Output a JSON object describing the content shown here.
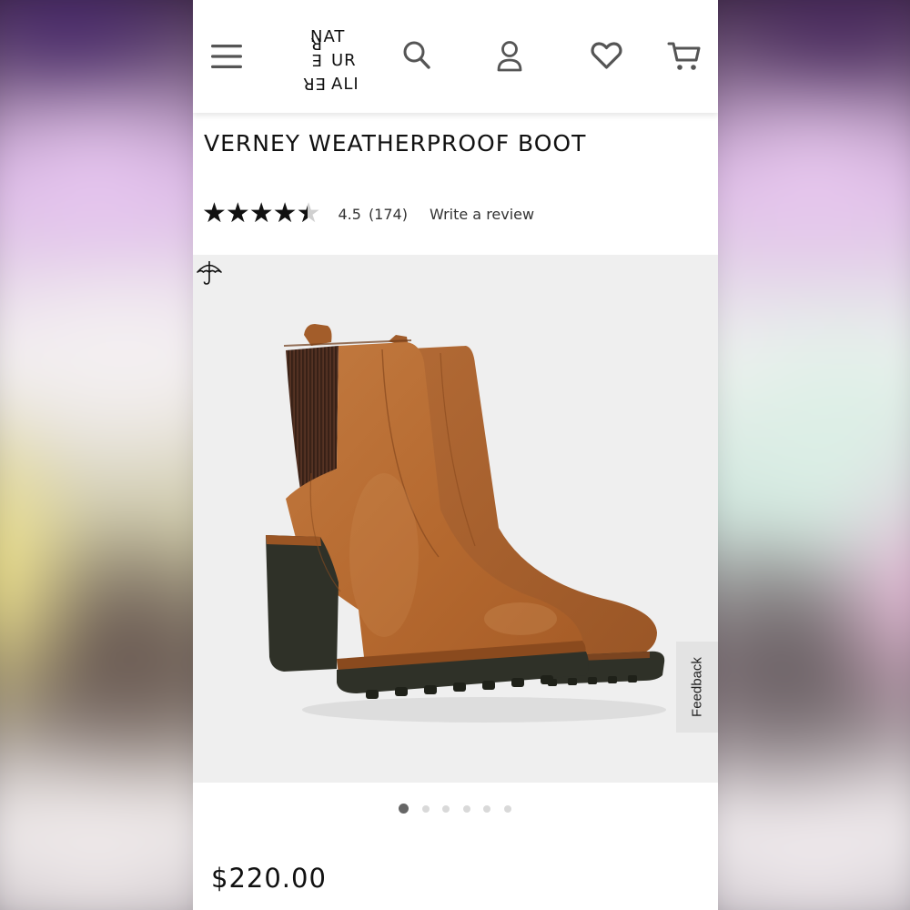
{
  "header": {
    "logo_lines": [
      "NAT",
      "UR",
      "ALIZ",
      "ER"
    ],
    "icons": [
      "menu-icon",
      "search-icon",
      "account-icon",
      "heart-icon",
      "cart-icon"
    ]
  },
  "product": {
    "title": "VERNEY WEATHERPROOF BOOT",
    "rating_value": "4.5",
    "rating_fraction": 0.9,
    "review_count": "(174)",
    "write_review_label": "Write a review",
    "price": "$220.00"
  },
  "gallery": {
    "badge_icon": "umbrella-icon",
    "image_description_icon": "boot-photo",
    "dots_total": 6,
    "active_dot": 1
  },
  "feedback": {
    "label": "Feedback"
  },
  "colors": {
    "boot_leather": "#b46a33",
    "boot_sole": "#2f3128",
    "elastic_gore": "#4a2e22",
    "image_bg": "#efefef",
    "text": "#111111"
  }
}
